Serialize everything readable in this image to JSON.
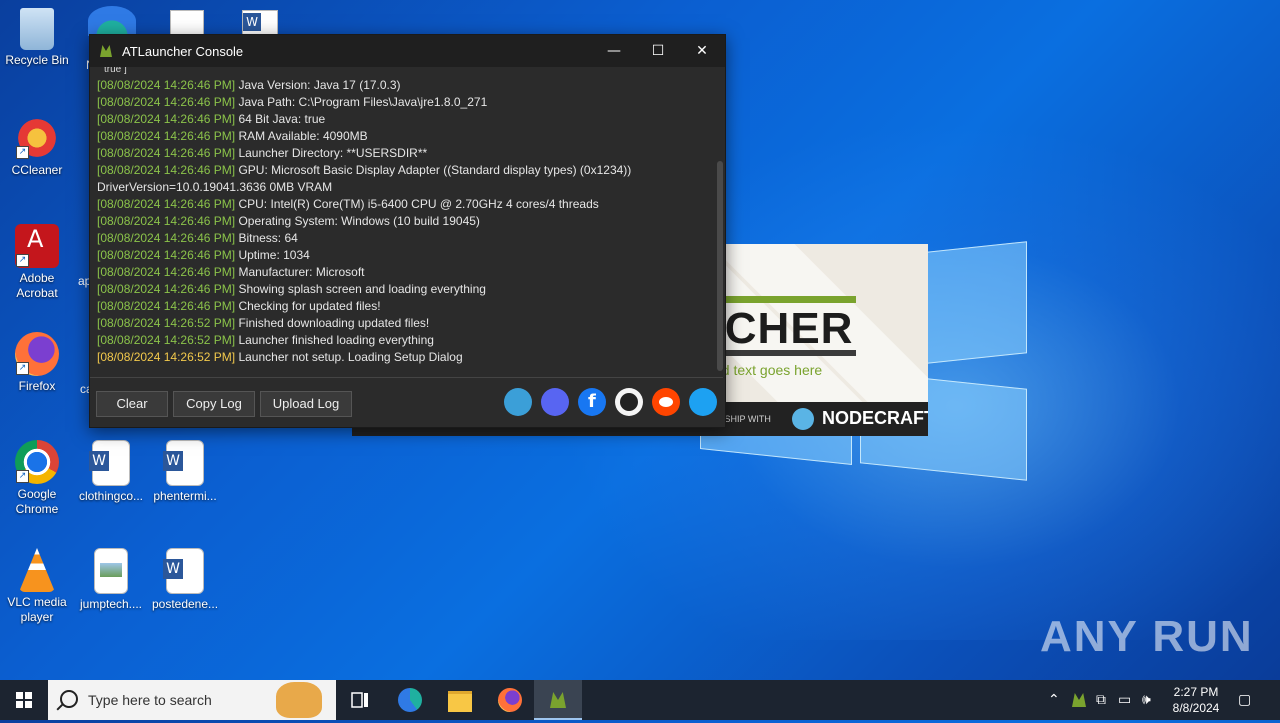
{
  "desktop": {
    "icons": [
      {
        "label": "Recycle Bin"
      },
      {
        "label": "CCleaner"
      },
      {
        "label": "Adobe Acrobat"
      },
      {
        "label": "Firefox"
      },
      {
        "label": "Google Chrome"
      },
      {
        "label": "VLC media player"
      },
      {
        "label": "clothingco..."
      },
      {
        "label": "phentermi..."
      },
      {
        "label": "jumptech...."
      },
      {
        "label": "postedene..."
      }
    ],
    "partial_labels": {
      "col2_a": "N",
      "col2_b": "ap",
      "col2_c": "ca"
    },
    "watermark": "ANY RUN"
  },
  "splash": {
    "brand": "NCHER",
    "tagline": "nd text goes here",
    "partnership": "ERSHIP WITH",
    "partner": "NODECRAFT"
  },
  "console": {
    "title": "ATLauncher Console",
    "controls": {
      "minimize": "—",
      "maximize": "☐",
      "close": "✕"
    },
    "cut_line": "true ]",
    "lines": [
      {
        "ts": "[08/08/2024 14:26:46 PM]",
        "msg": "Java Version: Java 17 (17.0.3)"
      },
      {
        "ts": "[08/08/2024 14:26:46 PM]",
        "msg": "Java Path: C:\\Program Files\\Java\\jre1.8.0_271"
      },
      {
        "ts": "[08/08/2024 14:26:46 PM]",
        "msg": "64 Bit Java: true"
      },
      {
        "ts": "[08/08/2024 14:26:46 PM]",
        "msg": "RAM Available: 4090MB"
      },
      {
        "ts": "[08/08/2024 14:26:46 PM]",
        "msg": "Launcher Directory: **USERSDIR**"
      },
      {
        "ts": "[08/08/2024 14:26:46 PM]",
        "msg": "GPU: Microsoft Basic Display Adapter ((Standard display types) (0x1234))"
      },
      {
        "ts": "",
        "msg": "DriverVersion=10.0.19041.3636 0MB VRAM"
      },
      {
        "ts": "[08/08/2024 14:26:46 PM]",
        "msg": "CPU: Intel(R) Core(TM) i5-6400 CPU @ 2.70GHz 4 cores/4 threads"
      },
      {
        "ts": "[08/08/2024 14:26:46 PM]",
        "msg": "Operating System: Windows (10 build 19045)"
      },
      {
        "ts": "[08/08/2024 14:26:46 PM]",
        "msg": "Bitness: 64"
      },
      {
        "ts": "[08/08/2024 14:26:46 PM]",
        "msg": "Uptime: 1034"
      },
      {
        "ts": "[08/08/2024 14:26:46 PM]",
        "msg": "Manufacturer: Microsoft"
      },
      {
        "ts": "[08/08/2024 14:26:46 PM]",
        "msg": "Showing splash screen and loading everything"
      },
      {
        "ts": "[08/08/2024 14:26:46 PM]",
        "msg": "Checking for updated files!"
      },
      {
        "ts": "[08/08/2024 14:26:52 PM]",
        "msg": "Finished downloading updated files!"
      },
      {
        "ts": "[08/08/2024 14:26:52 PM]",
        "msg": "Launcher finished loading everything"
      },
      {
        "ts": "[08/08/2024 14:26:52 PM]",
        "msg": "Launcher not setup. Loading Setup Dialog"
      }
    ],
    "buttons": {
      "clear": "Clear",
      "copy": "Copy Log",
      "upload": "Upload Log"
    },
    "social": [
      "nodecraft-icon",
      "discord-icon",
      "facebook-icon",
      "github-icon",
      "reddit-icon",
      "twitter-icon"
    ],
    "colors": {
      "timestamp": "#8bc34a",
      "timestamp_last": "#f2c94c",
      "text": "#e6e6e6",
      "bg": "#2b2b2b"
    }
  },
  "taskbar": {
    "search_placeholder": "Type here to search",
    "time": "2:27 PM",
    "date": "8/8/2024"
  }
}
